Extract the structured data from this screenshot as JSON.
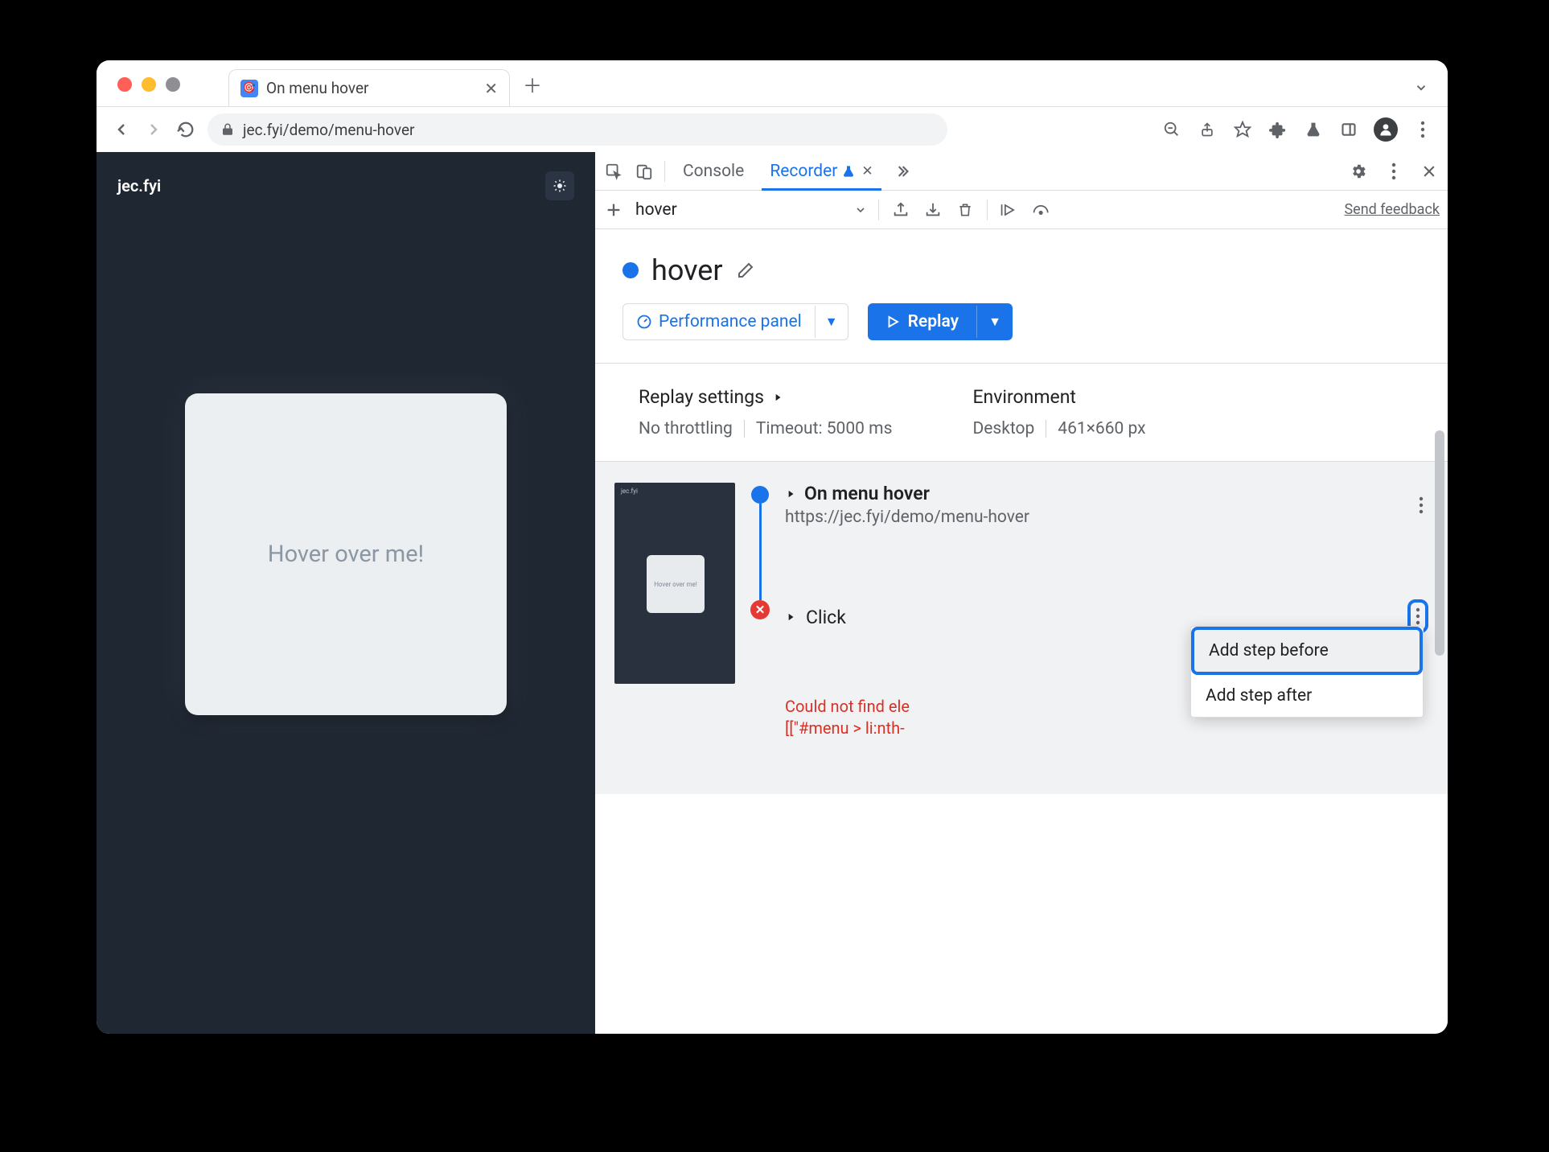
{
  "browser": {
    "tab_title": "On menu hover",
    "url": "jec.fyi/demo/menu-hover"
  },
  "page": {
    "brand": "jec.fyi",
    "hover_card_text": "Hover over me!"
  },
  "devtools": {
    "tabs": {
      "console": "Console",
      "recorder": "Recorder"
    },
    "toolbar": {
      "recording_name": "hover",
      "feedback": "Send feedback"
    },
    "title": "hover",
    "buttons": {
      "performance": "Performance panel",
      "replay": "Replay"
    },
    "settings": {
      "replay_label": "Replay settings",
      "throttling": "No throttling",
      "timeout": "Timeout: 5000 ms",
      "env_label": "Environment",
      "device": "Desktop",
      "viewport": "461×660 px"
    },
    "steps": {
      "first": {
        "title": "On menu hover",
        "url": "https://jec.fyi/demo/menu-hover"
      },
      "second": {
        "title": "Click"
      },
      "thumb_text": "Hover over me!",
      "error_line1": "Could not find ele",
      "error_line2": "[[\"#menu > li:nth-"
    },
    "context_menu": {
      "before": "Add step before",
      "after": "Add step after"
    }
  }
}
